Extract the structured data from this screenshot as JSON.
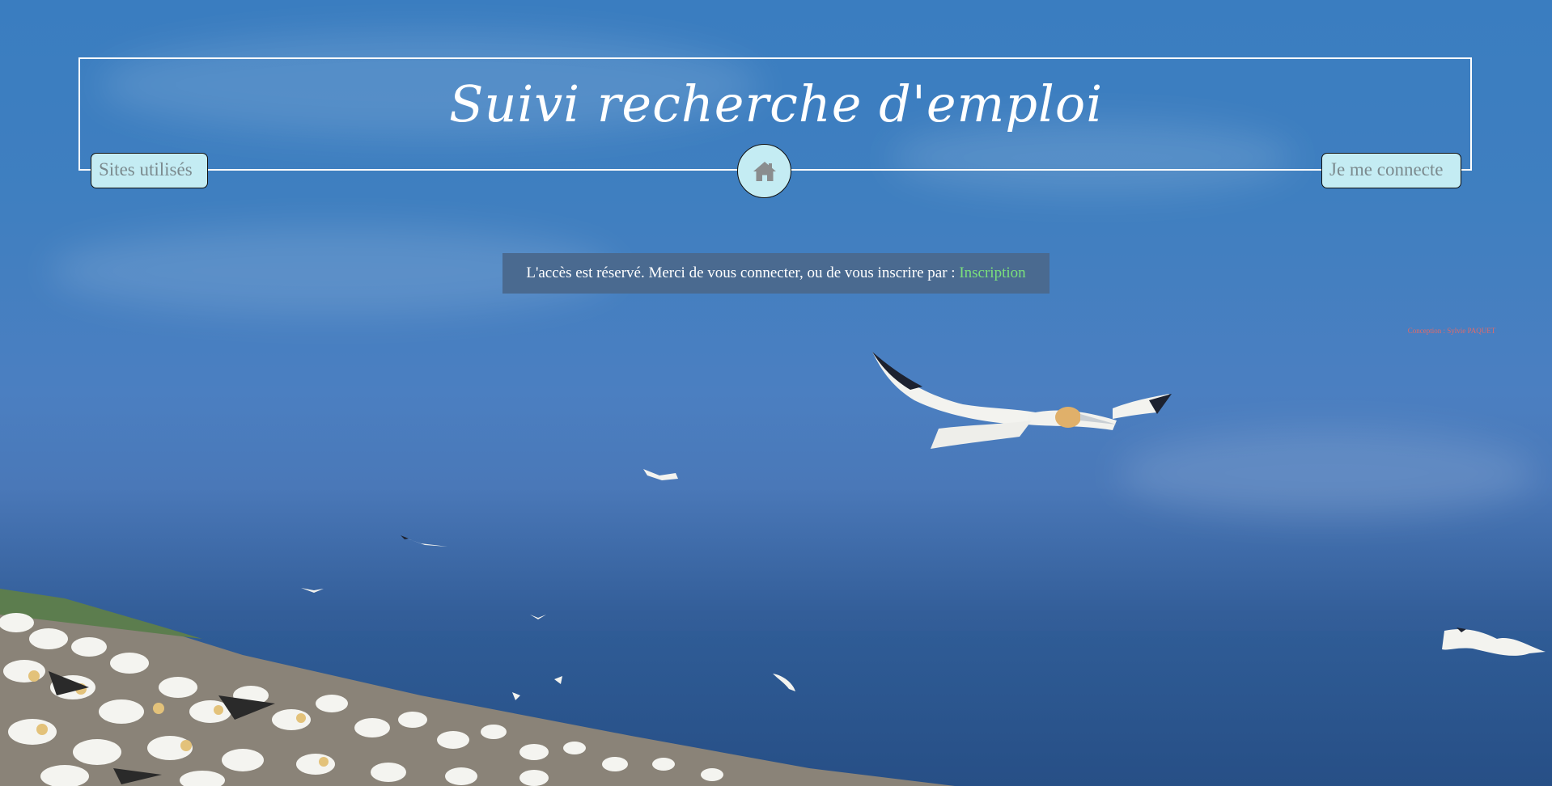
{
  "header": {
    "title": "Suivi recherche d'emploi"
  },
  "nav": {
    "left_label": "Sites utilisés",
    "home_icon": "home-icon",
    "right_label": "Je me connecte"
  },
  "notice": {
    "text": "L'accès est réservé. Merci de vous connecter, ou de vous inscrire par : ",
    "link_label": "Inscription"
  },
  "footer": {
    "credit": "Conception : Sylvie PAQUET"
  },
  "colors": {
    "button_bg": "#c4ecf3",
    "link": "#7be07b",
    "credit": "#e06a6a",
    "notice_bg": "#4a6a90"
  }
}
